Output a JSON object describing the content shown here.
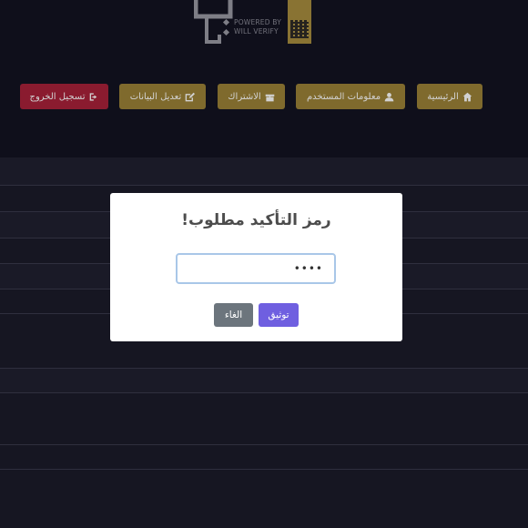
{
  "logo": {
    "powered_line1": "POWERED BY",
    "powered_line2": "WILL VERIFY"
  },
  "nav": {
    "logout": "تسجيل الخروج",
    "edit_data": "تعديل البيانات",
    "subscription": "الاشتراك",
    "user_info": "معلومات المستخدم",
    "home": "الرئيسية"
  },
  "modal": {
    "title": "رمز التأكيد مطلوب!",
    "code_value": "••••",
    "confirm_label": "توثيق",
    "cancel_label": "الغاء"
  },
  "colors": {
    "gold": "#9c8237",
    "red": "#a9213a",
    "confirm": "#6f5fe0",
    "cancel": "#6c757d"
  }
}
